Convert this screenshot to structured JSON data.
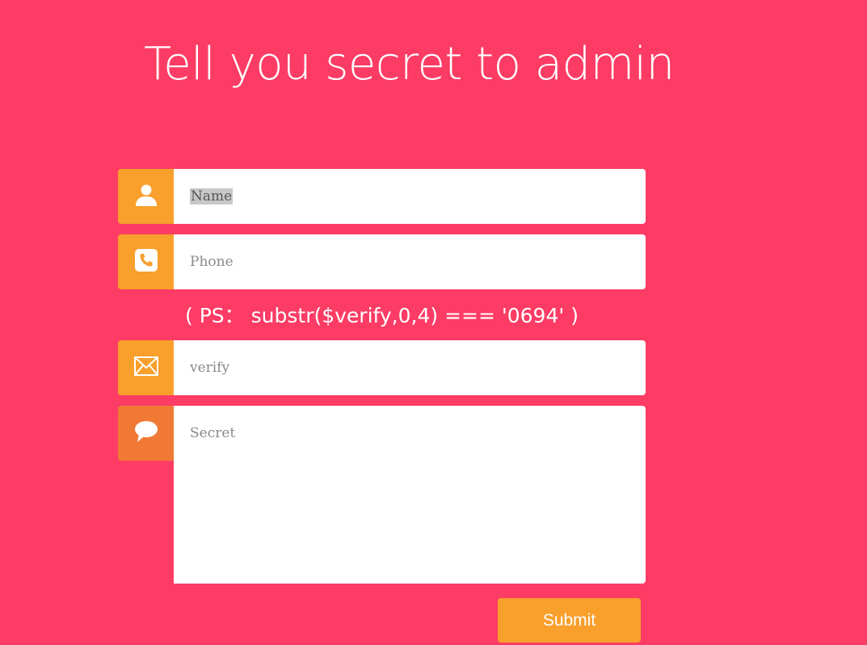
{
  "title": "Tell you secret to admin",
  "form": {
    "name": {
      "placeholder": "Name",
      "icon": "user-icon"
    },
    "phone": {
      "placeholder": "Phone",
      "icon": "phone-icon"
    },
    "hint": "( PS： substr($verify,0,4) === '0694' )",
    "verify": {
      "placeholder": "verify",
      "icon": "envelope-icon"
    },
    "secret": {
      "placeholder": "Secret",
      "icon": "speech-bubble-icon"
    },
    "submit_label": "Submit"
  },
  "colors": {
    "background": "#fc3c65",
    "icon_box": "#f89f2c",
    "icon_box_message": "#f07a35",
    "submit": "#f89f2c"
  }
}
